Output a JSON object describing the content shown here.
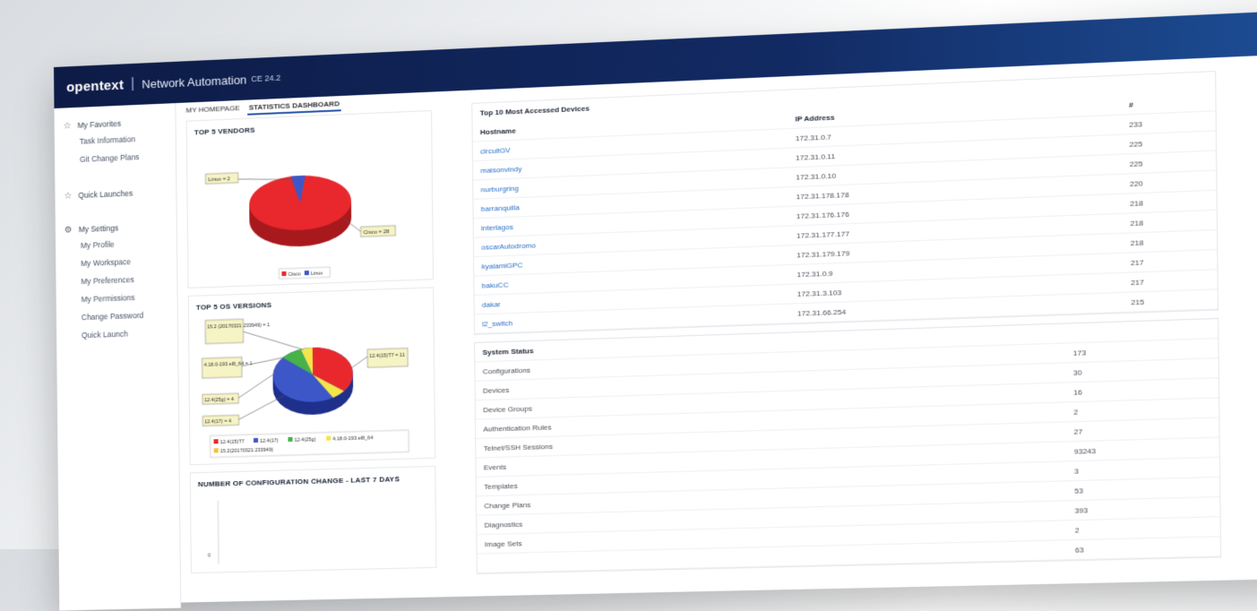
{
  "app": {
    "logo": "opentext",
    "product": "Network Automation",
    "version": "CE 24.2"
  },
  "tabs": [
    {
      "label": "MY HOMEPAGE",
      "active": false
    },
    {
      "label": "STATISTICS DASHBOARD",
      "active": true
    }
  ],
  "sidebar": {
    "favorites": {
      "label": "My Favorites",
      "items": [
        "Task Information",
        "Git Change Plans"
      ]
    },
    "quick": {
      "label": "Quick Launches"
    },
    "settings": {
      "label": "My Settings",
      "items": [
        "My Profile",
        "My Workspace",
        "My Preferences",
        "My Permissions",
        "Change Password",
        "Quick Launch"
      ]
    }
  },
  "vendors_panel": {
    "title": "TOP 5 VENDORS",
    "callouts": [
      "Linux = 2",
      "Cisco = 28"
    ],
    "legend": [
      "Cisco",
      "Linux"
    ]
  },
  "os_panel": {
    "title": "TOP 5 OS VERSIONS",
    "callouts": [
      "15.2 (20170321 233949) = 1",
      "4.18.0-193 el8_64 = 1",
      "12.4(25g) = 4",
      "12.4(17) = 4",
      "12.4(15)T7 = 11"
    ],
    "legend": [
      "12.4(15)T7",
      "12.4(17)",
      "12.4(25g)",
      "4.18.0-193.el8_64",
      "15.2(20170321:233949)"
    ]
  },
  "config_panel": {
    "title": "NUMBER OF CONFIGURATION CHANGE - LAST 7 DAYS",
    "axis_label": "0"
  },
  "accessed": {
    "title": "Top 10 Most Accessed Devices",
    "headers": {
      "host": "Hostname",
      "ip": "IP Address",
      "n": "#"
    },
    "rows": [
      {
        "host": "circuitGV",
        "ip": "172.31.0.7",
        "n": "233"
      },
      {
        "host": "maisonvindy",
        "ip": "172.31.0.11",
        "n": "225"
      },
      {
        "host": "nurburgring",
        "ip": "172.31.0.10",
        "n": "225"
      },
      {
        "host": "barranquilla",
        "ip": "172.31.178.178",
        "n": "220"
      },
      {
        "host": "interlagos",
        "ip": "172.31.176.176",
        "n": "218"
      },
      {
        "host": "oscarAutodromo",
        "ip": "172.31.177.177",
        "n": "218"
      },
      {
        "host": "kyalamiGPC",
        "ip": "172.31.179.179",
        "n": "218"
      },
      {
        "host": "bakuCC",
        "ip": "172.31.0.9",
        "n": "217"
      },
      {
        "host": "dakar",
        "ip": "172.31.3.103",
        "n": "217"
      },
      {
        "host": "l2_switch",
        "ip": "172.31.66.254",
        "n": "215"
      }
    ]
  },
  "system_status": {
    "title": "System Status",
    "rows": [
      {
        "label": "Configurations",
        "value": "173"
      },
      {
        "label": "Devices",
        "value": "30"
      },
      {
        "label": "Device Groups",
        "value": "16"
      },
      {
        "label": "Authentication Rules",
        "value": "2"
      },
      {
        "label": "Telnet/SSH Sessions",
        "value": "27"
      },
      {
        "label": "Events",
        "value": "93243"
      },
      {
        "label": "Templates",
        "value": "3"
      },
      {
        "label": "Change Plans",
        "value": "53"
      },
      {
        "label": "Diagnostics",
        "value": "393"
      },
      {
        "label": "Image Sets",
        "value": "2"
      },
      {
        "label": "",
        "value": "63"
      }
    ]
  },
  "colors": {
    "header": "#0d1b46",
    "accent": "#2a56a8",
    "pie_red": "#e8282d",
    "pie_blue": "#3d57c9",
    "pie_green": "#46b24a",
    "pie_yellow": "#f4e54a"
  }
}
